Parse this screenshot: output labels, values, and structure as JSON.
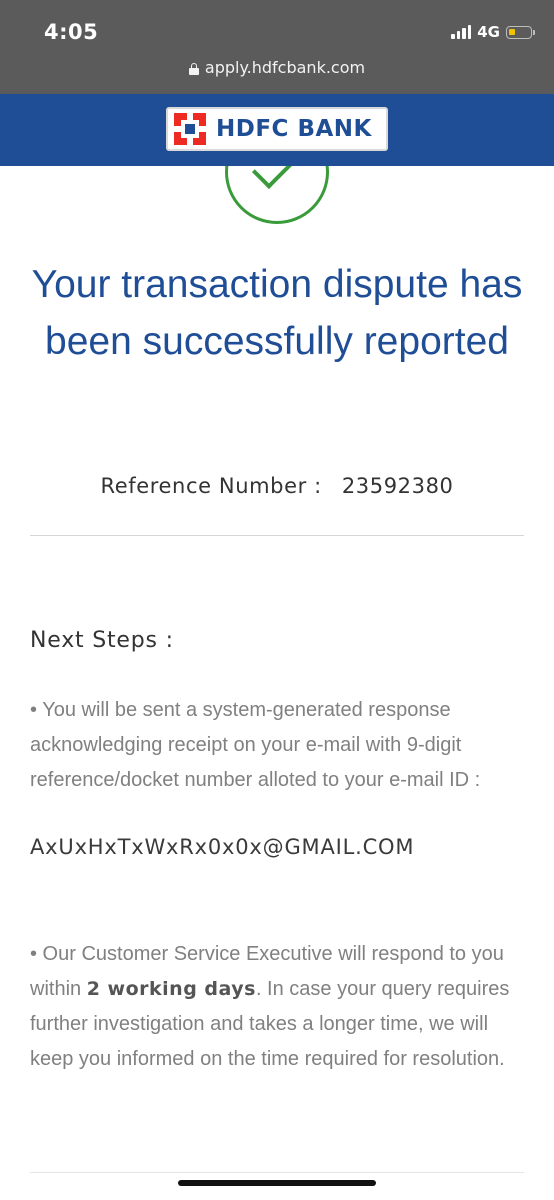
{
  "status_bar": {
    "time": "4:05",
    "network": "4G",
    "battery_color": "#f2c200"
  },
  "browser": {
    "url": "apply.hdfcbank.com",
    "lock_icon": "lock-icon"
  },
  "brand": {
    "logo_text": "HDFC BANK",
    "bar_color": "#1f4e96",
    "logo_accent": "#ed2b23"
  },
  "success": {
    "icon": "check-circle-icon",
    "icon_color": "#3a9b3a",
    "heading": "Your transaction dispute has been successfully reported",
    "reference_label": "Reference Number :",
    "reference_number": "23592380"
  },
  "next_steps": {
    "title": "Next Steps :",
    "step1": "• You will be sent a system-generated response acknowledging receipt on your e-mail with 9-digit reference/docket number alloted to your e-mail ID :",
    "email": "AxUxHxTxWxRx0x0x@GMAIL.COM",
    "step2_before": "• Our Customer Service Executive will respond to you within ",
    "step2_bold": "2 working days",
    "step2_after": ". In case your query requires further investigation and takes a longer time, we will keep you informed on the time required for resolution."
  }
}
